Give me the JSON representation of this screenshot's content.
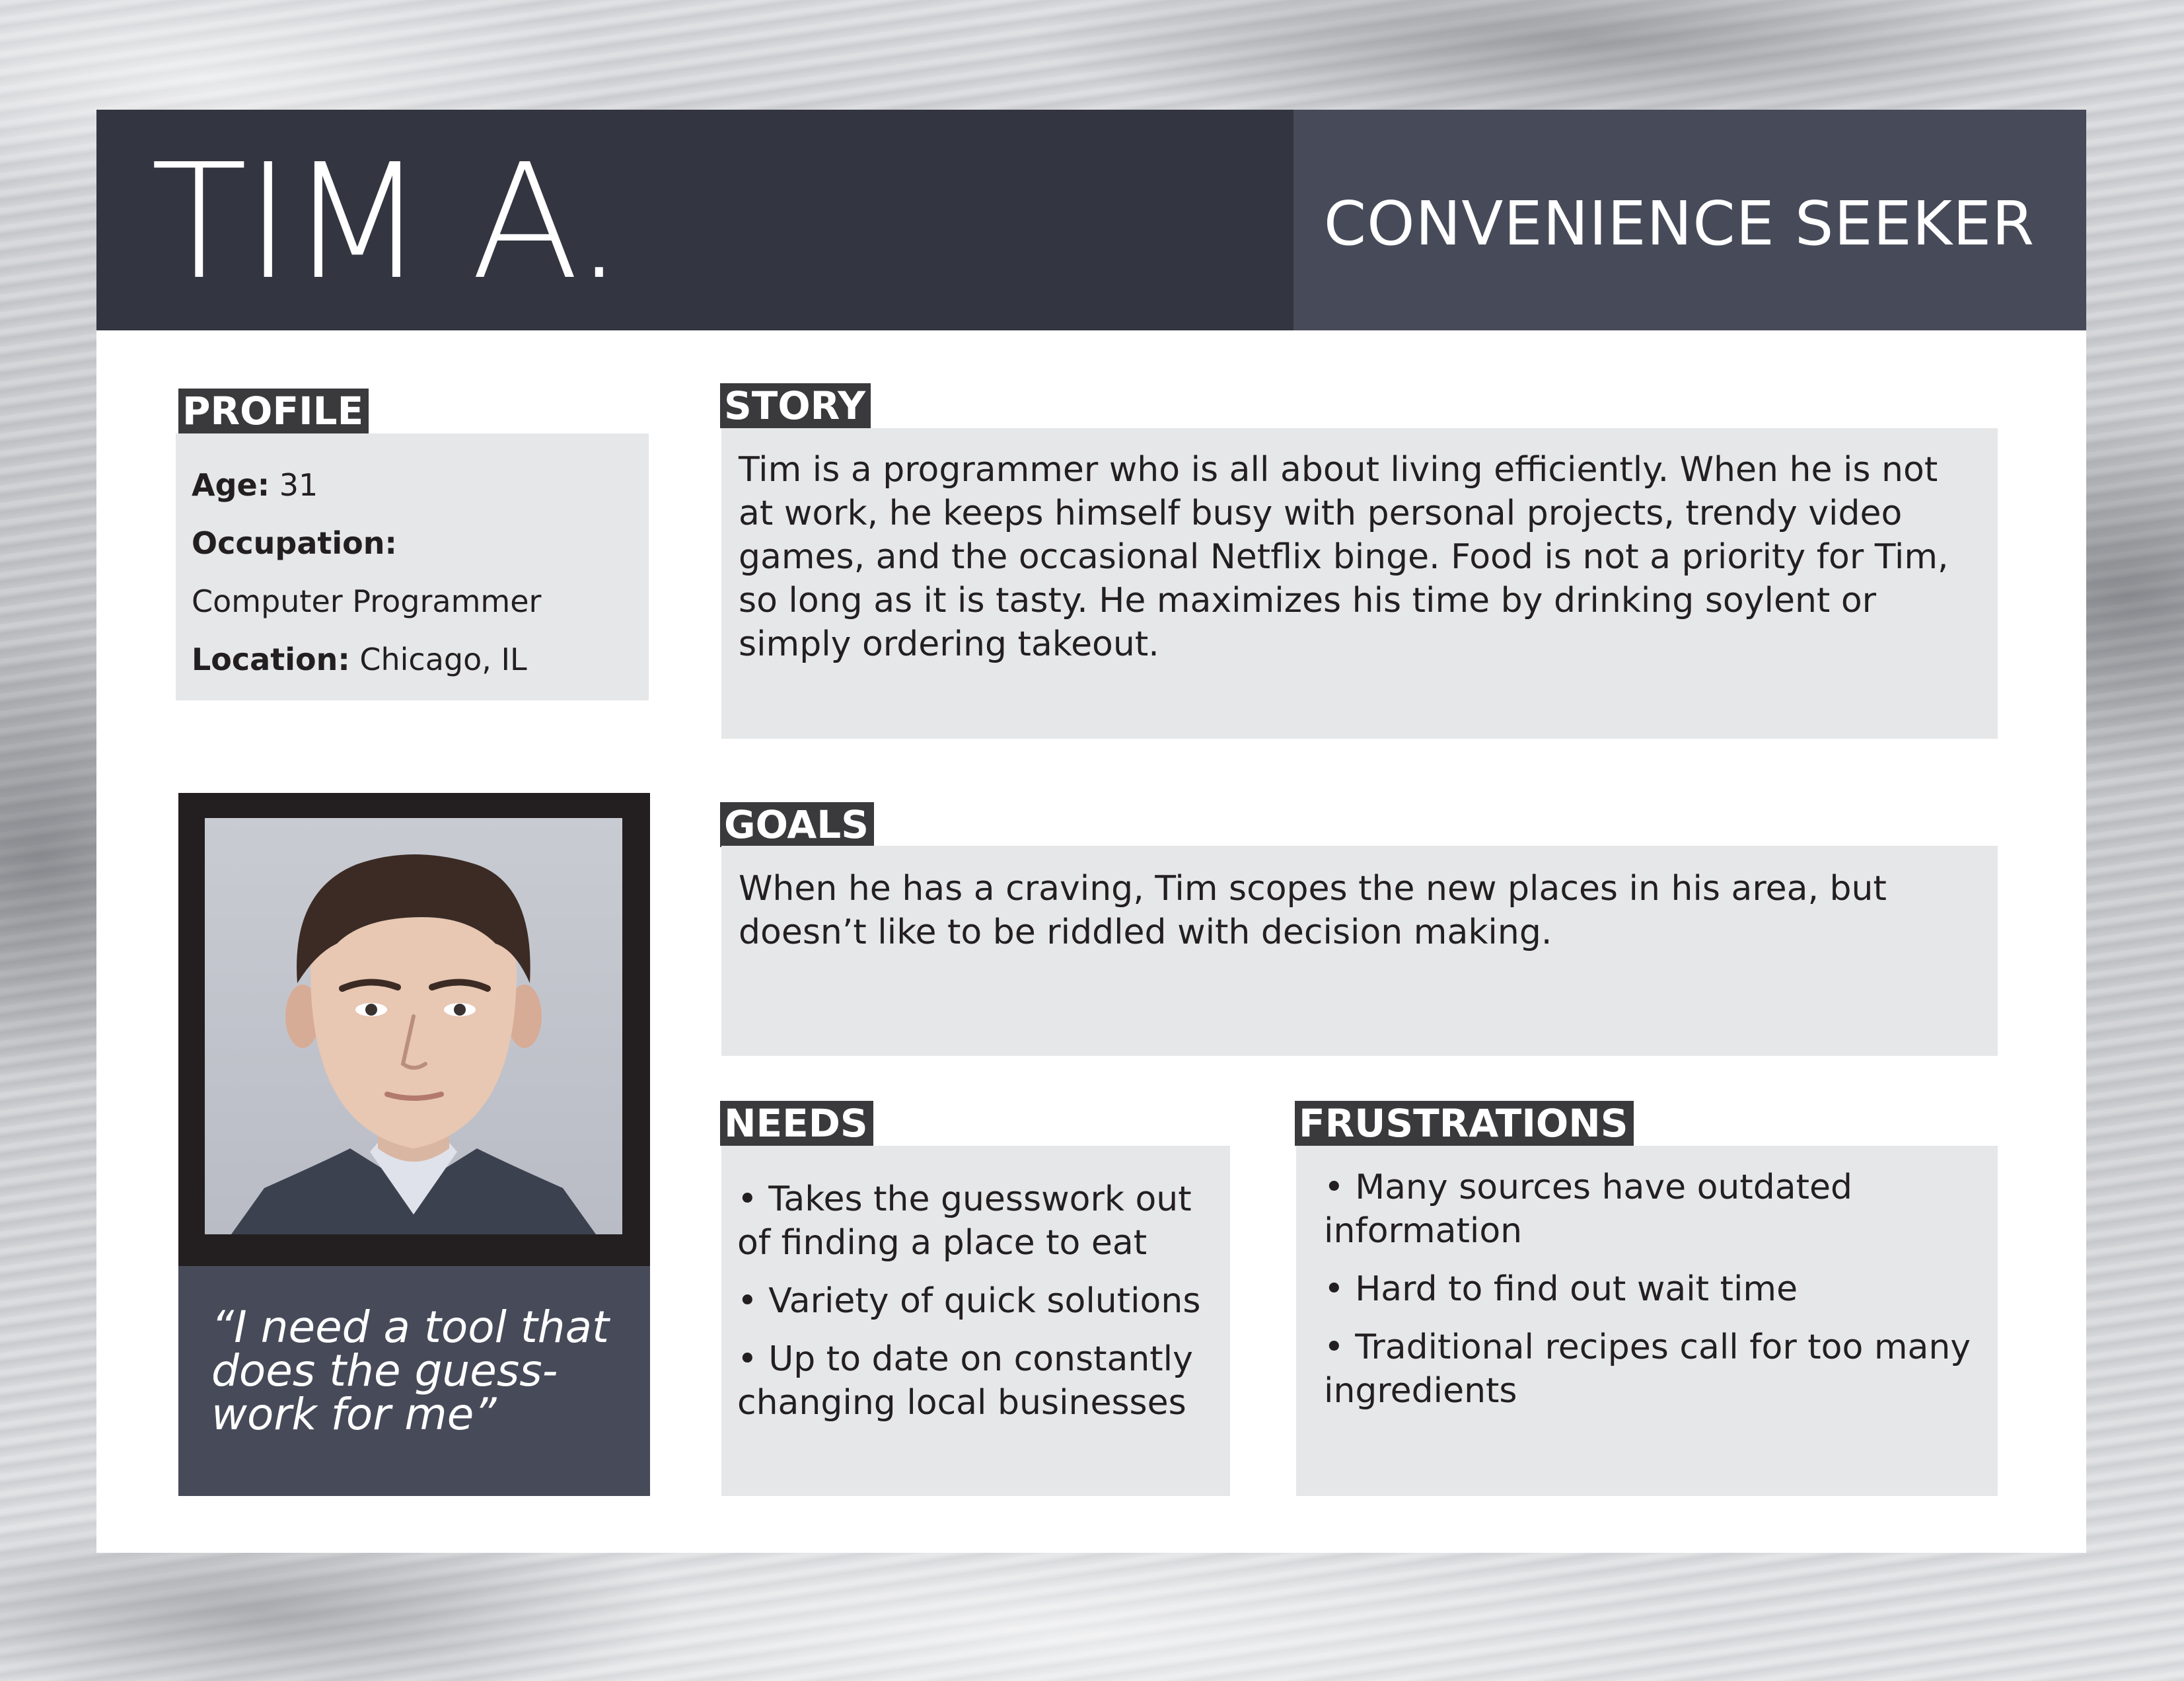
{
  "persona": {
    "name": "TIM A.",
    "type": "CONVENIENCE SEEKER"
  },
  "profile": {
    "label": "PROFILE",
    "age_label": "Age:",
    "age_value": "31",
    "occupation_label": "Occupation:",
    "occupation_value": "Computer Programmer",
    "location_label": "Location:",
    "location_value": "Chicago, IL"
  },
  "story": {
    "label": "STORY",
    "text": "Tim is a programmer who is all about living efficiently. When he is not at work, he keeps himself busy with personal projects, trendy video games, and the occasional Netflix binge. Food is not a priority for Tim, so long as it is tasty. He maximizes his time by drinking soylent or simply ordering takeout."
  },
  "goals": {
    "label": "GOALS",
    "text": "When he has a craving, Tim scopes the new places in his area, but doesn’t like to be riddled with decision making."
  },
  "needs": {
    "label": "NEEDS",
    "items": [
      "• Takes the guesswork out of finding a place to eat",
      "• Variety of quick solutions",
      "• Up to date on constantly changing local businesses"
    ]
  },
  "frustrations": {
    "label": "FRUSTRATIONS",
    "items": [
      "• Many sources have outdated information",
      "• Hard to find out wait time",
      "• Traditional recipes call for too many ingredients"
    ]
  },
  "quote": {
    "text": "“I need a tool that does the guess-work for me”"
  },
  "colors": {
    "header_dark": "#333640",
    "header_slate": "#474b59",
    "label_bg": "#3a3a3c",
    "box_bg": "#e6e7e8"
  }
}
